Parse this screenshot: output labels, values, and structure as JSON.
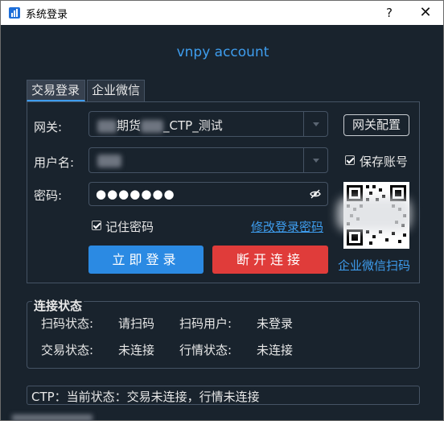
{
  "window": {
    "title": "系统登录",
    "help_glyph": "?",
    "close_glyph": "✕"
  },
  "heading": "vnpy account",
  "tabs": [
    {
      "label": "交易登录",
      "active": true
    },
    {
      "label": "企业微信",
      "active": false
    }
  ],
  "form": {
    "gateway_label": "网关:",
    "gateway_value_visible": "期货",
    "gateway_value_suffix": "_CTP_测试",
    "username_label": "用户名:",
    "password_label": "密码:",
    "password_mask": "●●●●●●●",
    "gateway_config_button": "网关配置",
    "save_account_label": "保存账号",
    "remember_password_label": "记住密码",
    "change_password_link": "修改登录密码",
    "login_button": "立即登录",
    "disconnect_button": "断开连接",
    "wechat_scan_link": "企业微信扫码"
  },
  "status_group": {
    "title": "连接状态",
    "scan_status_label": "扫码状态:",
    "scan_status_value": "请扫码",
    "scan_user_label": "扫码用户:",
    "scan_user_value": "未登录",
    "trade_status_label": "交易状态:",
    "trade_status_value": "未连接",
    "market_status_label": "行情状态:",
    "market_status_value": "未连接"
  },
  "status_bar": "CTP：当前状态：交易未连接，行情未连接",
  "colors": {
    "background": "#19232d",
    "accent": "#3e9dee",
    "primary_button": "#2b8ae3",
    "danger_button": "#e03c3a",
    "border": "#455364"
  }
}
